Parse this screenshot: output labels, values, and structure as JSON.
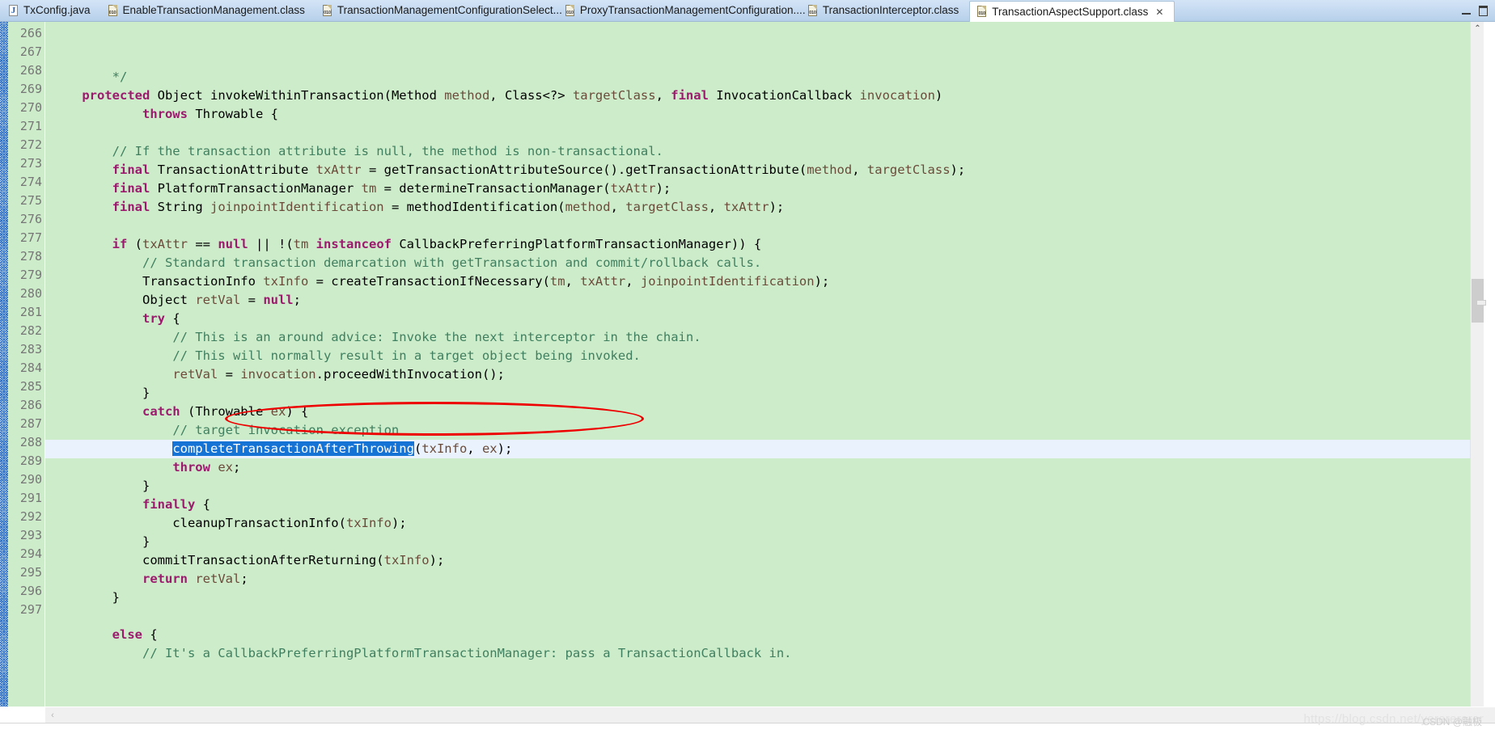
{
  "window": {
    "title": "TransactionAspectSupport.class",
    "minimize_label": "–",
    "maximize_label": "❐"
  },
  "tabs": [
    {
      "label": "TxConfig.java",
      "icon": "java-file-icon",
      "kind": "java",
      "active": false
    },
    {
      "label": "EnableTransactionManagement.class",
      "icon": "class-file-icon",
      "kind": "class",
      "active": false
    },
    {
      "label": "TransactionManagementConfigurationSelect...",
      "icon": "class-file-icon",
      "kind": "class",
      "active": false
    },
    {
      "label": "ProxyTransactionManagementConfiguration....",
      "icon": "class-file-icon",
      "kind": "class",
      "active": false
    },
    {
      "label": "TransactionInterceptor.class",
      "icon": "class-file-icon",
      "kind": "class",
      "active": false
    },
    {
      "label": "TransactionAspectSupport.class",
      "icon": "class-file-icon",
      "kind": "class",
      "active": true,
      "close_label": "✕"
    }
  ],
  "editor": {
    "first_line": 266,
    "last_line": 297,
    "current_line": 286,
    "selection_text": "completeTransactionAfterThrowing",
    "fold_marker_line": 267,
    "lines": [
      {
        "n": "266",
        "tokens": [
          {
            "t": "        */",
            "c": "cmt"
          }
        ]
      },
      {
        "n": "267",
        "fold": true,
        "tokens": [
          {
            "t": "    ",
            "c": "txt"
          },
          {
            "t": "protected",
            "c": "kw"
          },
          {
            "t": " Object invokeWithinTransaction(Method ",
            "c": "txt"
          },
          {
            "t": "method",
            "c": "loc"
          },
          {
            "t": ", Class<?> ",
            "c": "txt"
          },
          {
            "t": "targetClass",
            "c": "loc"
          },
          {
            "t": ", ",
            "c": "txt"
          },
          {
            "t": "final",
            "c": "kw"
          },
          {
            "t": " InvocationCallback ",
            "c": "txt"
          },
          {
            "t": "invocation",
            "c": "loc"
          },
          {
            "t": ")",
            "c": "txt"
          }
        ]
      },
      {
        "n": "268",
        "tokens": [
          {
            "t": "            ",
            "c": "txt"
          },
          {
            "t": "throws",
            "c": "kw"
          },
          {
            "t": " Throwable {",
            "c": "txt"
          }
        ]
      },
      {
        "n": "269",
        "tokens": [
          {
            "t": "",
            "c": "txt"
          }
        ]
      },
      {
        "n": "270",
        "tokens": [
          {
            "t": "        ",
            "c": "txt"
          },
          {
            "t": "// If the transaction attribute is null, the method is non-transactional.",
            "c": "cmt"
          }
        ]
      },
      {
        "n": "271",
        "tokens": [
          {
            "t": "        ",
            "c": "txt"
          },
          {
            "t": "final",
            "c": "kw"
          },
          {
            "t": " TransactionAttribute ",
            "c": "txt"
          },
          {
            "t": "txAttr",
            "c": "loc"
          },
          {
            "t": " = getTransactionAttributeSource().getTransactionAttribute(",
            "c": "txt"
          },
          {
            "t": "method",
            "c": "loc"
          },
          {
            "t": ", ",
            "c": "txt"
          },
          {
            "t": "targetClass",
            "c": "loc"
          },
          {
            "t": ");",
            "c": "txt"
          }
        ]
      },
      {
        "n": "272",
        "tokens": [
          {
            "t": "        ",
            "c": "txt"
          },
          {
            "t": "final",
            "c": "kw"
          },
          {
            "t": " PlatformTransactionManager ",
            "c": "txt"
          },
          {
            "t": "tm",
            "c": "loc"
          },
          {
            "t": " = determineTransactionManager(",
            "c": "txt"
          },
          {
            "t": "txAttr",
            "c": "loc"
          },
          {
            "t": ");",
            "c": "txt"
          }
        ]
      },
      {
        "n": "273",
        "tokens": [
          {
            "t": "        ",
            "c": "txt"
          },
          {
            "t": "final",
            "c": "kw"
          },
          {
            "t": " String ",
            "c": "txt"
          },
          {
            "t": "joinpointIdentification",
            "c": "loc"
          },
          {
            "t": " = methodIdentification(",
            "c": "txt"
          },
          {
            "t": "method",
            "c": "loc"
          },
          {
            "t": ", ",
            "c": "txt"
          },
          {
            "t": "targetClass",
            "c": "loc"
          },
          {
            "t": ", ",
            "c": "txt"
          },
          {
            "t": "txAttr",
            "c": "loc"
          },
          {
            "t": ");",
            "c": "txt"
          }
        ]
      },
      {
        "n": "274",
        "tokens": [
          {
            "t": "",
            "c": "txt"
          }
        ]
      },
      {
        "n": "275",
        "tokens": [
          {
            "t": "        ",
            "c": "txt"
          },
          {
            "t": "if",
            "c": "kw"
          },
          {
            "t": " (",
            "c": "txt"
          },
          {
            "t": "txAttr",
            "c": "loc"
          },
          {
            "t": " == ",
            "c": "txt"
          },
          {
            "t": "null",
            "c": "kw"
          },
          {
            "t": " || !(",
            "c": "txt"
          },
          {
            "t": "tm",
            "c": "loc"
          },
          {
            "t": " ",
            "c": "txt"
          },
          {
            "t": "instanceof",
            "c": "kw"
          },
          {
            "t": " CallbackPreferringPlatformTransactionManager)) {",
            "c": "txt"
          }
        ]
      },
      {
        "n": "276",
        "tokens": [
          {
            "t": "            ",
            "c": "txt"
          },
          {
            "t": "// Standard transaction demarcation with getTransaction and commit/rollback calls.",
            "c": "cmt"
          }
        ]
      },
      {
        "n": "277",
        "tokens": [
          {
            "t": "            TransactionInfo ",
            "c": "txt"
          },
          {
            "t": "txInfo",
            "c": "loc"
          },
          {
            "t": " = createTransactionIfNecessary(",
            "c": "txt"
          },
          {
            "t": "tm",
            "c": "loc"
          },
          {
            "t": ", ",
            "c": "txt"
          },
          {
            "t": "txAttr",
            "c": "loc"
          },
          {
            "t": ", ",
            "c": "txt"
          },
          {
            "t": "joinpointIdentification",
            "c": "loc"
          },
          {
            "t": ");",
            "c": "txt"
          }
        ]
      },
      {
        "n": "278",
        "tokens": [
          {
            "t": "            Object ",
            "c": "txt"
          },
          {
            "t": "retVal",
            "c": "loc"
          },
          {
            "t": " = ",
            "c": "txt"
          },
          {
            "t": "null",
            "c": "kw"
          },
          {
            "t": ";",
            "c": "txt"
          }
        ]
      },
      {
        "n": "279",
        "tokens": [
          {
            "t": "            ",
            "c": "txt"
          },
          {
            "t": "try",
            "c": "kw"
          },
          {
            "t": " {",
            "c": "txt"
          }
        ]
      },
      {
        "n": "280",
        "tokens": [
          {
            "t": "                ",
            "c": "txt"
          },
          {
            "t": "// This is an around advice: Invoke the next interceptor in the chain.",
            "c": "cmt"
          }
        ]
      },
      {
        "n": "281",
        "tokens": [
          {
            "t": "                ",
            "c": "txt"
          },
          {
            "t": "// This will normally result in a target object being invoked.",
            "c": "cmt"
          }
        ]
      },
      {
        "n": "282",
        "tokens": [
          {
            "t": "                ",
            "c": "txt"
          },
          {
            "t": "retVal",
            "c": "loc"
          },
          {
            "t": " = ",
            "c": "txt"
          },
          {
            "t": "invocation",
            "c": "loc"
          },
          {
            "t": ".proceedWithInvocation();",
            "c": "txt"
          }
        ]
      },
      {
        "n": "283",
        "tokens": [
          {
            "t": "            }",
            "c": "txt"
          }
        ]
      },
      {
        "n": "284",
        "tokens": [
          {
            "t": "            ",
            "c": "txt"
          },
          {
            "t": "catch",
            "c": "kw"
          },
          {
            "t": " (Throwable ",
            "c": "txt"
          },
          {
            "t": "ex",
            "c": "loc"
          },
          {
            "t": ") {",
            "c": "txt"
          }
        ]
      },
      {
        "n": "285",
        "tokens": [
          {
            "t": "                ",
            "c": "txt"
          },
          {
            "t": "// target invocation exception",
            "c": "cmt"
          }
        ]
      },
      {
        "n": "286",
        "current": true,
        "tokens": [
          {
            "t": "                ",
            "c": "txt"
          },
          {
            "t": "completeTransactionAfterThrowing",
            "c": "sel"
          },
          {
            "t": "(",
            "c": "txt"
          },
          {
            "t": "txInfo",
            "c": "loc"
          },
          {
            "t": ", ",
            "c": "txt"
          },
          {
            "t": "ex",
            "c": "loc"
          },
          {
            "t": ");",
            "c": "txt"
          }
        ]
      },
      {
        "n": "287",
        "tokens": [
          {
            "t": "                ",
            "c": "txt"
          },
          {
            "t": "throw",
            "c": "kw"
          },
          {
            "t": " ",
            "c": "txt"
          },
          {
            "t": "ex",
            "c": "loc"
          },
          {
            "t": ";",
            "c": "txt"
          }
        ]
      },
      {
        "n": "288",
        "tokens": [
          {
            "t": "            }",
            "c": "txt"
          }
        ]
      },
      {
        "n": "289",
        "tokens": [
          {
            "t": "            ",
            "c": "txt"
          },
          {
            "t": "finally",
            "c": "kw"
          },
          {
            "t": " {",
            "c": "txt"
          }
        ]
      },
      {
        "n": "290",
        "tokens": [
          {
            "t": "                cleanupTransactionInfo(",
            "c": "txt"
          },
          {
            "t": "txInfo",
            "c": "loc"
          },
          {
            "t": ");",
            "c": "txt"
          }
        ]
      },
      {
        "n": "291",
        "tokens": [
          {
            "t": "            }",
            "c": "txt"
          }
        ]
      },
      {
        "n": "292",
        "tokens": [
          {
            "t": "            commitTransactionAfterReturning(",
            "c": "txt"
          },
          {
            "t": "txInfo",
            "c": "loc"
          },
          {
            "t": ");",
            "c": "txt"
          }
        ]
      },
      {
        "n": "293",
        "tokens": [
          {
            "t": "            ",
            "c": "txt"
          },
          {
            "t": "return",
            "c": "kw"
          },
          {
            "t": " ",
            "c": "txt"
          },
          {
            "t": "retVal",
            "c": "loc"
          },
          {
            "t": ";",
            "c": "txt"
          }
        ]
      },
      {
        "n": "294",
        "tokens": [
          {
            "t": "        }",
            "c": "txt"
          }
        ]
      },
      {
        "n": "295",
        "tokens": [
          {
            "t": "",
            "c": "txt"
          }
        ]
      },
      {
        "n": "296",
        "tokens": [
          {
            "t": "        ",
            "c": "txt"
          },
          {
            "t": "else",
            "c": "kw"
          },
          {
            "t": " {",
            "c": "txt"
          }
        ]
      },
      {
        "n": "297",
        "tokens": [
          {
            "t": "            ",
            "c": "txt"
          },
          {
            "t": "// It's a CallbackPreferringPlatformTransactionManager: pass a TransactionCallback in.",
            "c": "cmt"
          }
        ]
      }
    ]
  },
  "scrollbars": {
    "vertical_up_arrow": "⌃",
    "vertical_down_arrow": "⌄",
    "horizontal_left_arrow": "‹",
    "horizontal_right_arrow": "›"
  },
  "watermark": {
    "url": "https://blog.csdn.net/yererererer",
    "badge": "CSDN @融极"
  },
  "colors": {
    "editor_background": "#cdecca",
    "current_line": "#eaf2fd",
    "selection": "#1573d6",
    "keyword": "#9c1a6e",
    "comment": "#3f7f5f",
    "local_variable": "#6a4b3a",
    "annotation_red": "#ee0000",
    "tabbar": "#c3d9f0"
  }
}
